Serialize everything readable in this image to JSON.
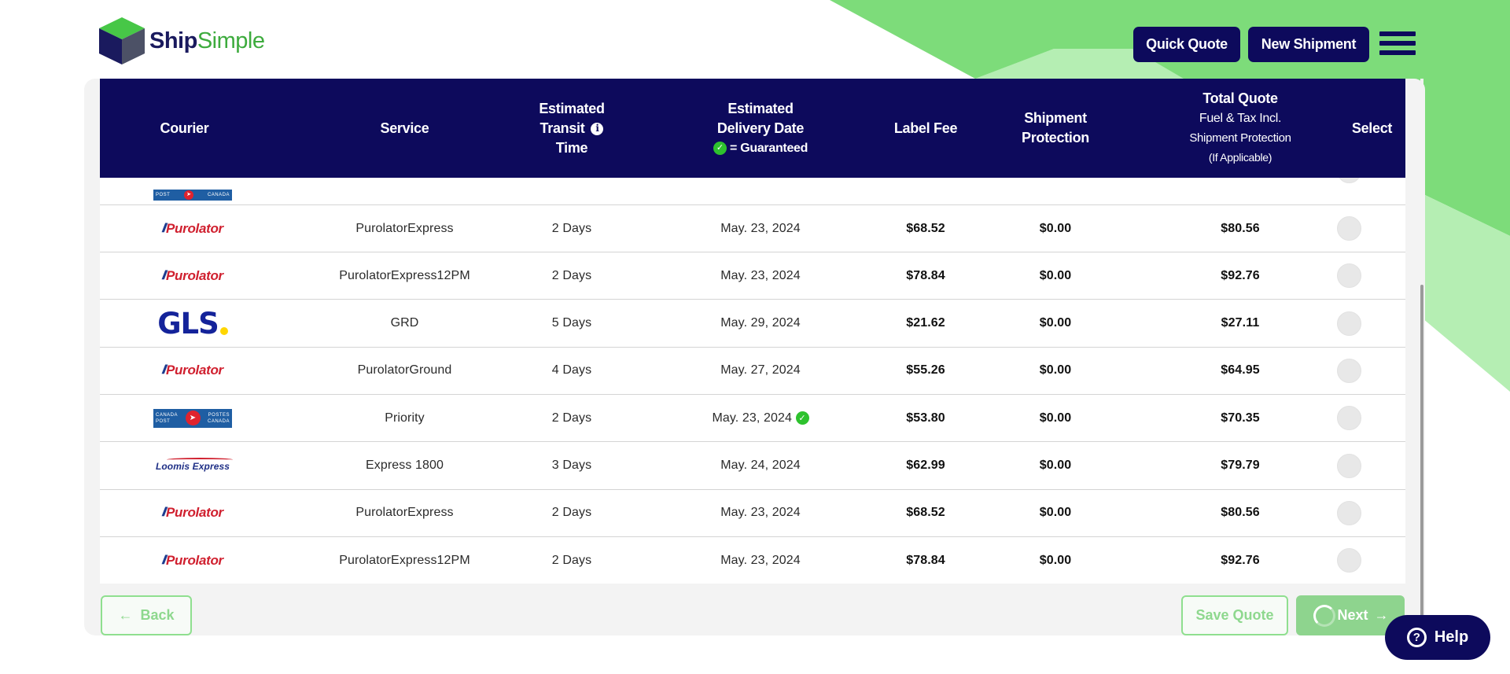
{
  "brand": {
    "name_part1": "Ship",
    "name_part2": "Simple"
  },
  "header": {
    "quick_quote_label": "Quick Quote",
    "new_shipment_label": "New Shipment"
  },
  "table": {
    "headers": {
      "courier": "Courier",
      "service": "Service",
      "transit_line1": "Estimated",
      "transit_line2": "Transit",
      "transit_line3": "Time",
      "delivery_line1": "Estimated",
      "delivery_line2": "Delivery Date",
      "delivery_line3": "= Guaranteed",
      "label_fee": "Label Fee",
      "protection_line1": "Shipment",
      "protection_line2": "Protection",
      "total_line1": "Total Quote",
      "total_line2": "Fuel & Tax Incl.",
      "total_line3": "Shipment Protection",
      "total_line4": "(If Applicable)",
      "select": "Select"
    },
    "partial_row_courier": "canada-post-logo",
    "rows": [
      {
        "courier": "Purolator",
        "service": "PurolatorExpress",
        "transit": "2 Days",
        "delivery": "May. 23, 2024",
        "guaranteed": false,
        "label_fee": "$68.52",
        "protection": "$0.00",
        "total": "$80.56"
      },
      {
        "courier": "Purolator",
        "service": "PurolatorExpress12PM",
        "transit": "2 Days",
        "delivery": "May. 23, 2024",
        "guaranteed": false,
        "label_fee": "$78.84",
        "protection": "$0.00",
        "total": "$92.76"
      },
      {
        "courier": "GLS",
        "service": "GRD",
        "transit": "5 Days",
        "delivery": "May. 29, 2024",
        "guaranteed": false,
        "label_fee": "$21.62",
        "protection": "$0.00",
        "total": "$27.11"
      },
      {
        "courier": "Purolator",
        "service": "PurolatorGround",
        "transit": "4 Days",
        "delivery": "May. 27, 2024",
        "guaranteed": false,
        "label_fee": "$55.26",
        "protection": "$0.00",
        "total": "$64.95"
      },
      {
        "courier": "Canada Post",
        "service": "Priority",
        "transit": "2 Days",
        "delivery": "May. 23, 2024",
        "guaranteed": true,
        "label_fee": "$53.80",
        "protection": "$0.00",
        "total": "$70.35"
      },
      {
        "courier": "Loomis Express",
        "service": "Express 1800",
        "transit": "3 Days",
        "delivery": "May. 24, 2024",
        "guaranteed": false,
        "label_fee": "$62.99",
        "protection": "$0.00",
        "total": "$79.79"
      },
      {
        "courier": "Purolator",
        "service": "PurolatorExpress",
        "transit": "2 Days",
        "delivery": "May. 23, 2024",
        "guaranteed": false,
        "label_fee": "$68.52",
        "protection": "$0.00",
        "total": "$80.56"
      },
      {
        "courier": "Purolator",
        "service": "PurolatorExpress12PM",
        "transit": "2 Days",
        "delivery": "May. 23, 2024",
        "guaranteed": false,
        "label_fee": "$78.84",
        "protection": "$0.00",
        "total": "$92.76"
      }
    ]
  },
  "footer": {
    "back_label": "Back",
    "save_quote_label": "Save Quote",
    "next_label": "Next"
  },
  "help": {
    "label": "Help"
  },
  "logos": {
    "purolator": "Purolator",
    "gls": "GLS",
    "loomis": "Loomis Express",
    "canada_post_en1": "CANADA",
    "canada_post_en2": "POST",
    "canada_post_fr1": "POSTES",
    "canada_post_fr2": "CANADA"
  },
  "colors": {
    "navy": "#0d0a5c",
    "green": "#7ddc7a",
    "light_green": "#b5eeb3"
  }
}
